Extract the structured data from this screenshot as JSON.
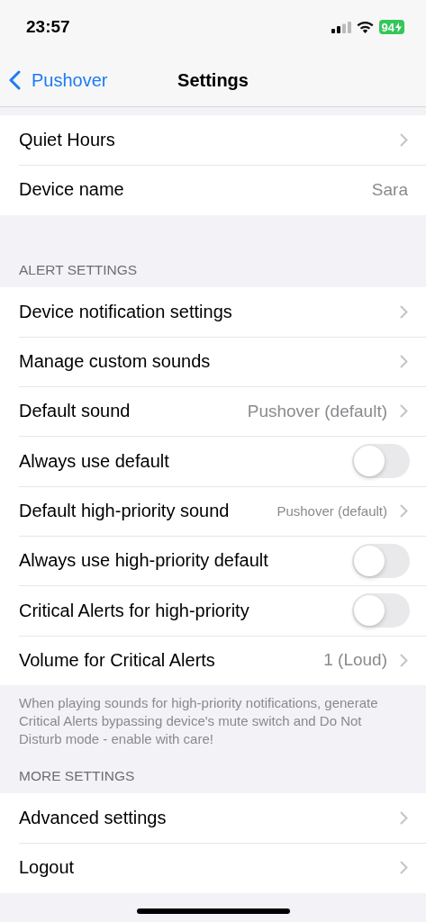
{
  "status_bar": {
    "time": "23:57",
    "battery": "94"
  },
  "nav": {
    "back": "Pushover",
    "title": "Settings"
  },
  "sections": [
    {
      "items": [
        {
          "kind": "link",
          "label": "Quiet Hours"
        },
        {
          "kind": "text",
          "label": "Device name",
          "value": "Sara"
        }
      ]
    },
    {
      "header": "ALERT SETTINGS",
      "footer": "When playing sounds for high-priority notifications, generate Critical Alerts bypassing device's mute switch and Do Not Disturb mode - enable with care!",
      "items": [
        {
          "kind": "link",
          "label": "Device notification settings"
        },
        {
          "kind": "link",
          "label": "Manage custom sounds"
        },
        {
          "kind": "link",
          "label": "Default sound",
          "value": "Pushover (default)"
        },
        {
          "kind": "toggle",
          "label": "Always use default",
          "on": false
        },
        {
          "kind": "link-compact",
          "label": "Default high-priority sound",
          "value": "Pushover (default)"
        },
        {
          "kind": "toggle",
          "label": "Always use high-priority default",
          "on": false
        },
        {
          "kind": "toggle",
          "label": "Critical Alerts for high-priority",
          "on": false
        },
        {
          "kind": "link",
          "label": "Volume for Critical Alerts",
          "value": "1 (Loud)"
        }
      ]
    },
    {
      "header": "MORE SETTINGS",
      "items": [
        {
          "kind": "link",
          "label": "Advanced settings"
        },
        {
          "kind": "link",
          "label": "Logout"
        }
      ]
    }
  ]
}
